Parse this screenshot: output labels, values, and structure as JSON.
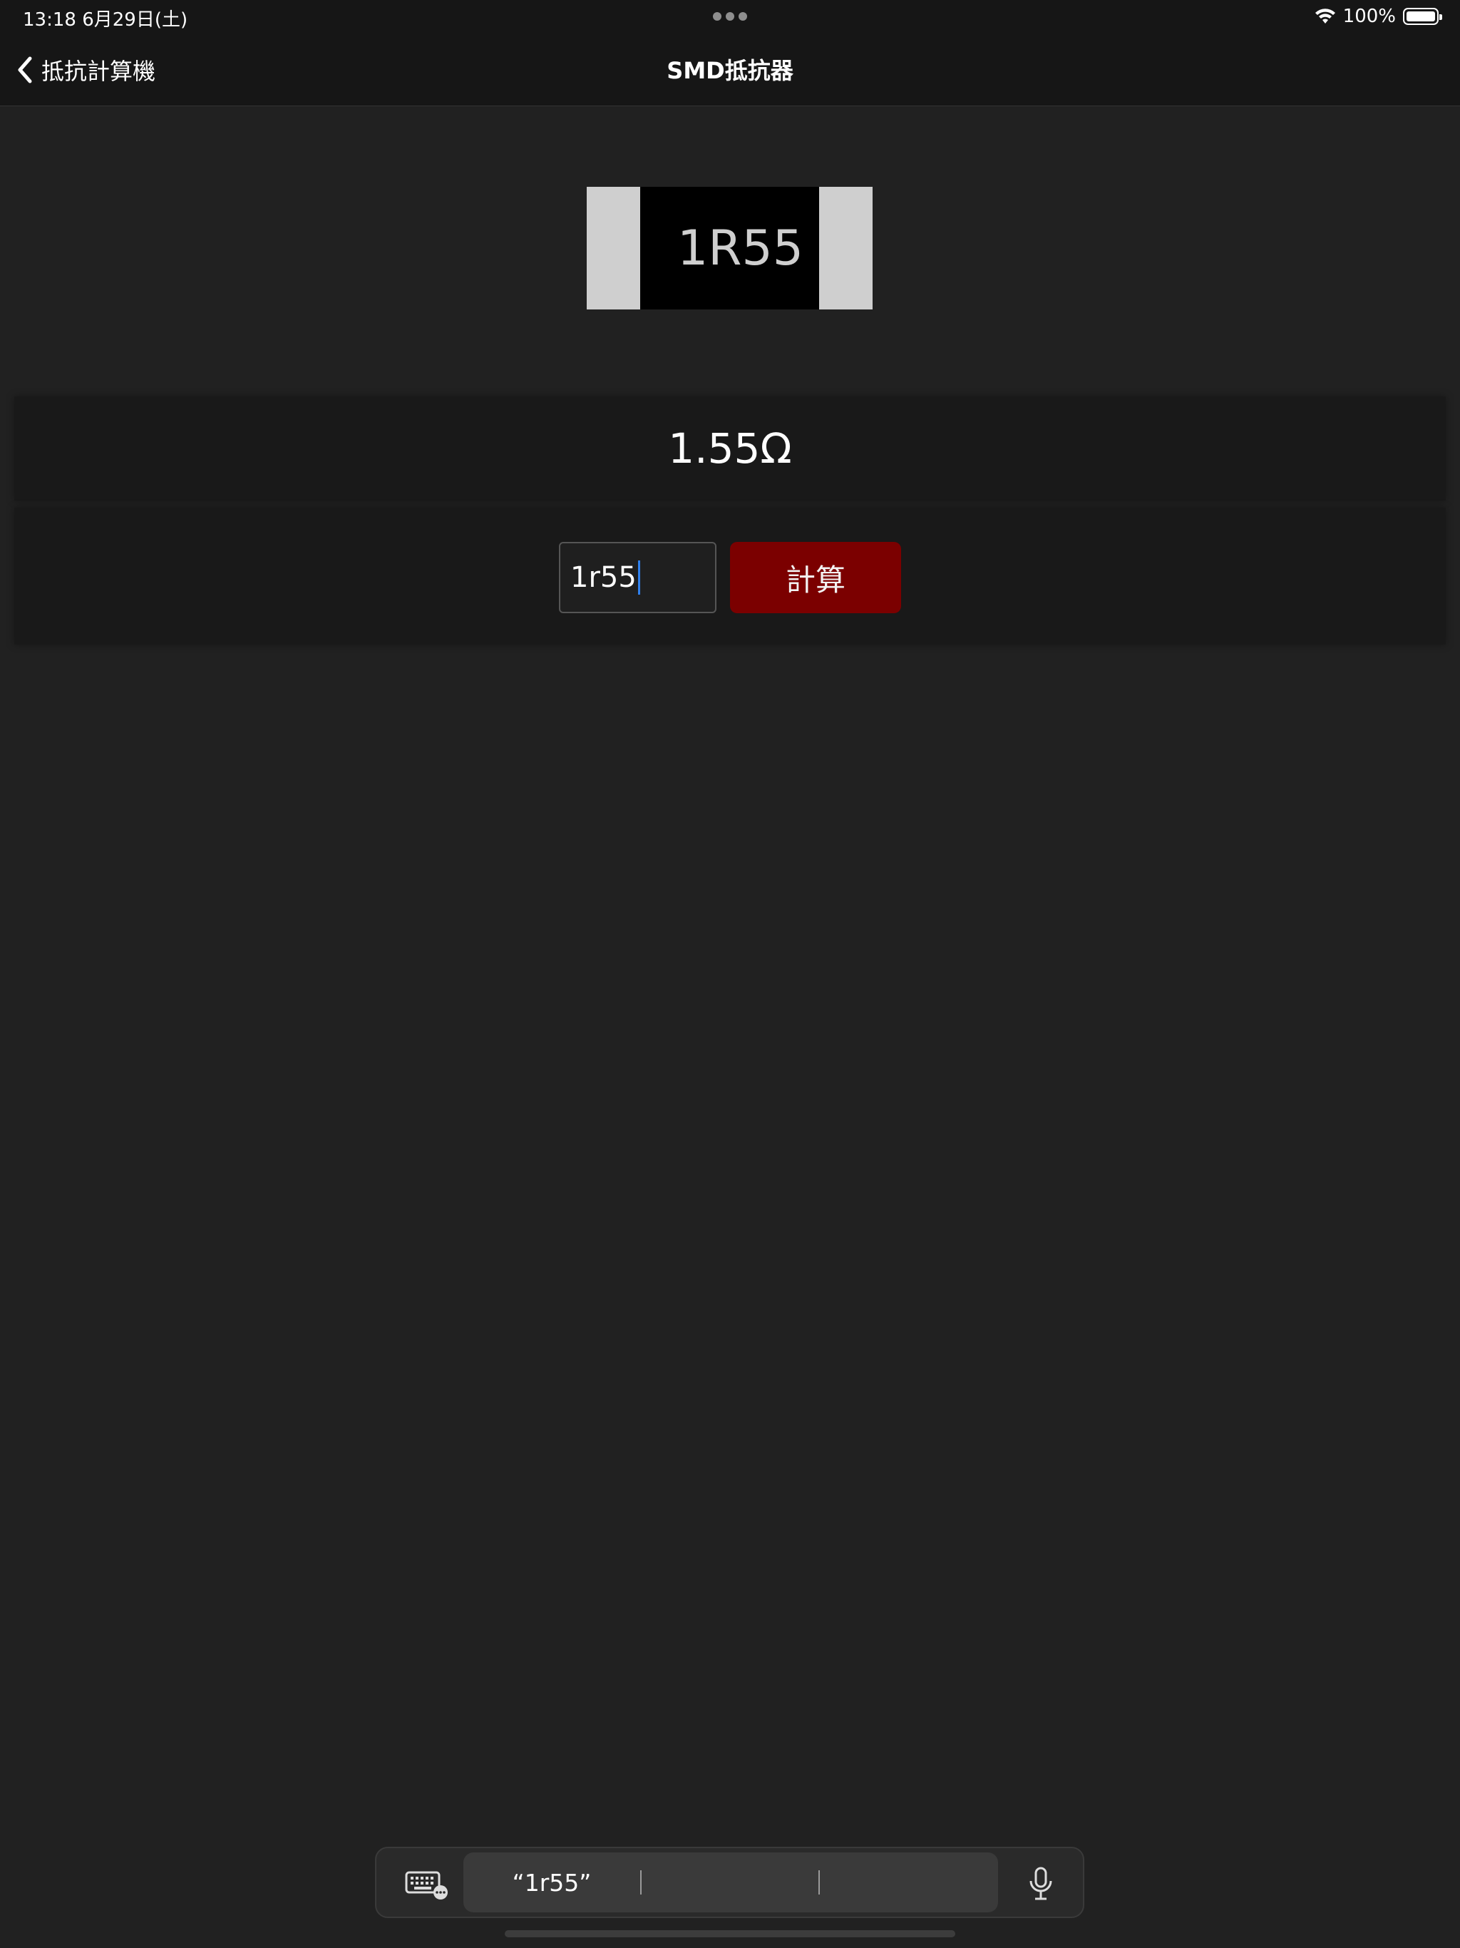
{
  "status_bar": {
    "time_date": "13:18   6月29日(土)",
    "battery_percent": "100%",
    "battery_level": 1.0
  },
  "nav": {
    "back_label": "抵抗計算機",
    "title": "SMD抵抗器"
  },
  "resistor": {
    "code": "1R55"
  },
  "result": {
    "value": "1.55Ω"
  },
  "input": {
    "value": "1r55",
    "calc_label": "計算"
  },
  "keyboard_bar": {
    "suggestion_1": "“1r55”",
    "suggestion_2": "",
    "suggestion_3": ""
  },
  "icons": {
    "back": "chevron-left-icon",
    "wifi": "wifi-icon",
    "battery": "battery-icon",
    "keyboard": "keyboard-icon",
    "mic": "microphone-icon",
    "multitask": "more-dots-icon"
  },
  "colors": {
    "background": "#212121",
    "bar": "#161616",
    "panel": "#191919",
    "button": "#7b0000",
    "resistor_cap": "#cfcfcf",
    "resistor_body": "#000000"
  }
}
